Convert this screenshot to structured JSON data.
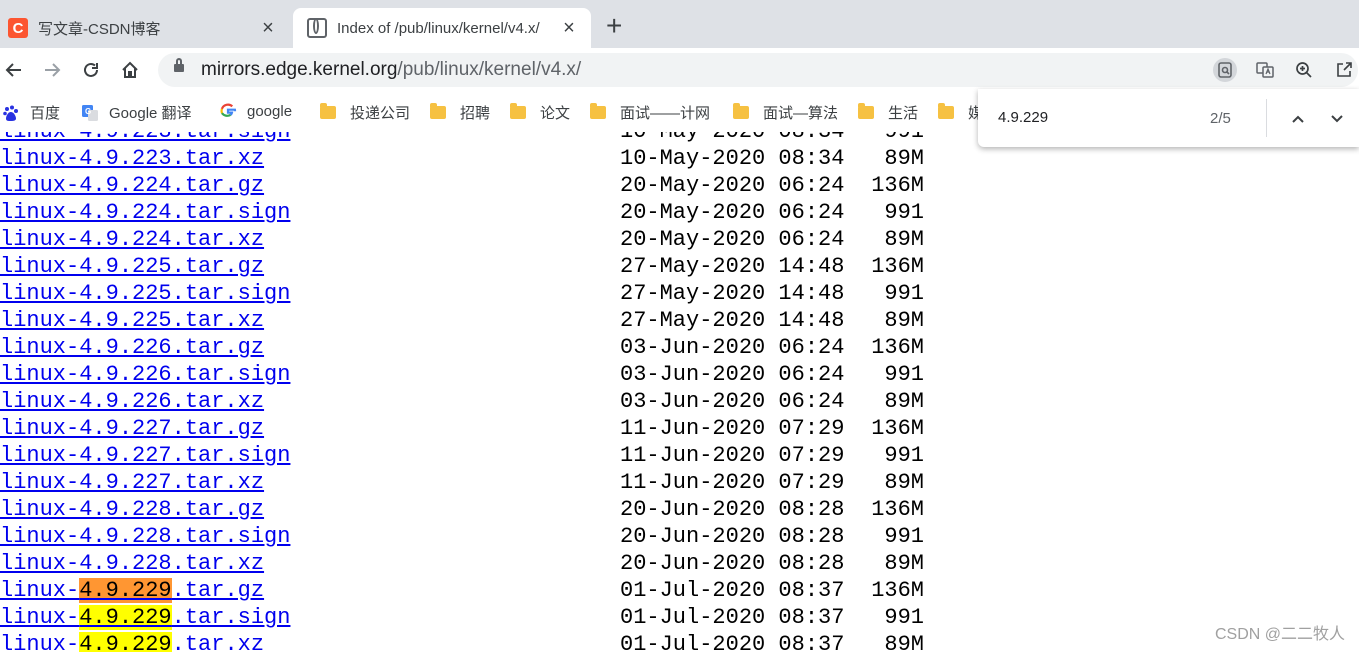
{
  "tabs": [
    {
      "title": "写文章-CSDN博客",
      "favicon": "csdn-icon",
      "favicon_text": "C"
    },
    {
      "title": "Index of /pub/linux/kernel/v4.x/",
      "favicon": "globe-icon"
    }
  ],
  "toolbar": {
    "url_host": "mirrors.edge.kernel.org",
    "url_path": "/pub/linux/kernel/v4.x/"
  },
  "bookmarks": [
    {
      "label": "百度",
      "icon": "baidu-icon"
    },
    {
      "label": "Google 翻译",
      "icon": "google-translate-icon"
    },
    {
      "label": "google",
      "icon": "google-icon"
    },
    {
      "label": "投递公司",
      "icon": "folder-icon"
    },
    {
      "label": "招聘",
      "icon": "folder-icon"
    },
    {
      "label": "论文",
      "icon": "folder-icon"
    },
    {
      "label": "面试——计网",
      "icon": "folder-icon"
    },
    {
      "label": "面试—算法",
      "icon": "folder-icon"
    },
    {
      "label": "生活",
      "icon": "folder-icon"
    },
    {
      "label": "媒",
      "icon": "folder-icon"
    }
  ],
  "find": {
    "query": "4.9.229",
    "count": "2/5"
  },
  "listing": [
    {
      "pre": "linux-4.9.223.tar.xz",
      "match": "",
      "post": "",
      "date": "10-May-2020 08:34",
      "size": "89M"
    },
    {
      "pre": "linux-4.9.224.tar.gz",
      "match": "",
      "post": "",
      "date": "20-May-2020 06:24",
      "size": "136M"
    },
    {
      "pre": "linux-4.9.224.tar.sign",
      "match": "",
      "post": "",
      "date": "20-May-2020 06:24",
      "size": "991"
    },
    {
      "pre": "linux-4.9.224.tar.xz",
      "match": "",
      "post": "",
      "date": "20-May-2020 06:24",
      "size": "89M"
    },
    {
      "pre": "linux-4.9.225.tar.gz",
      "match": "",
      "post": "",
      "date": "27-May-2020 14:48",
      "size": "136M"
    },
    {
      "pre": "linux-4.9.225.tar.sign",
      "match": "",
      "post": "",
      "date": "27-May-2020 14:48",
      "size": "991"
    },
    {
      "pre": "linux-4.9.225.tar.xz",
      "match": "",
      "post": "",
      "date": "27-May-2020 14:48",
      "size": "89M"
    },
    {
      "pre": "linux-4.9.226.tar.gz",
      "match": "",
      "post": "",
      "date": "03-Jun-2020 06:24",
      "size": "136M"
    },
    {
      "pre": "linux-4.9.226.tar.sign",
      "match": "",
      "post": "",
      "date": "03-Jun-2020 06:24",
      "size": "991"
    },
    {
      "pre": "linux-4.9.226.tar.xz",
      "match": "",
      "post": "",
      "date": "03-Jun-2020 06:24",
      "size": "89M"
    },
    {
      "pre": "linux-4.9.227.tar.gz",
      "match": "",
      "post": "",
      "date": "11-Jun-2020 07:29",
      "size": "136M"
    },
    {
      "pre": "linux-4.9.227.tar.sign",
      "match": "",
      "post": "",
      "date": "11-Jun-2020 07:29",
      "size": "991"
    },
    {
      "pre": "linux-4.9.227.tar.xz",
      "match": "",
      "post": "",
      "date": "11-Jun-2020 07:29",
      "size": "89M"
    },
    {
      "pre": "linux-4.9.228.tar.gz",
      "match": "",
      "post": "",
      "date": "20-Jun-2020 08:28",
      "size": "136M"
    },
    {
      "pre": "linux-4.9.228.tar.sign",
      "match": "",
      "post": "",
      "date": "20-Jun-2020 08:28",
      "size": "991"
    },
    {
      "pre": "linux-4.9.228.tar.xz",
      "match": "",
      "post": "",
      "date": "20-Jun-2020 08:28",
      "size": "89M"
    },
    {
      "pre": "linux-",
      "match": "4.9.229",
      "post": ".tar.gz",
      "current": true,
      "date": "01-Jul-2020 08:37",
      "size": "136M"
    },
    {
      "pre": "linux-",
      "match": "4.9.229",
      "post": ".tar.sign",
      "current": false,
      "date": "01-Jul-2020 08:37",
      "size": "991"
    },
    {
      "pre": "linux-",
      "match": "4.9.229",
      "post": ".tar.xz",
      "current": false,
      "date": "01-Jul-2020 08:37",
      "size": "89M"
    }
  ],
  "watermark": "CSDN @二二牧人",
  "colors": {
    "link": "#0000ee",
    "find_current_highlight": "#ff9632",
    "find_highlight": "#ffff00",
    "csdn_brand": "#fc5531"
  }
}
